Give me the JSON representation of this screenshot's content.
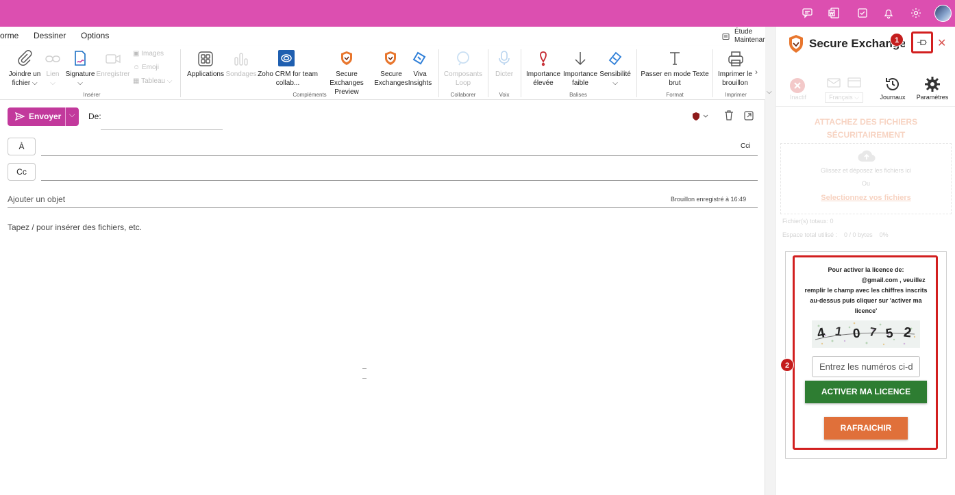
{
  "menubar": {
    "items": [
      "orme",
      "Dessiner",
      "Options"
    ],
    "etude_line1": "Étude",
    "etude_line2": "Maintenant"
  },
  "ribbon": {
    "inserer": {
      "joindre_1": "Joindre un",
      "joindre_2": "fichier",
      "lien": "Lien",
      "signature": "Signature",
      "enregistrer": "Enregistrer",
      "images": "Images",
      "emoji": "Emoji",
      "tableau": "Tableau",
      "group": "Insérer"
    },
    "complements": {
      "applications": "Applications",
      "sondages": "Sondages",
      "zoho_1": "Zoho CRM for team",
      "zoho_2": "collab...",
      "se_preview_1": "Secure Exchanges",
      "se_preview_2": "Preview",
      "se_1": "Secure",
      "se_2": "Exchanges",
      "viva_1": "Viva",
      "viva_2": "Insights",
      "group": "Compléments"
    },
    "collaborer": {
      "loop_1": "Composants",
      "loop_2": "Loop",
      "group": "Collaborer"
    },
    "voix": {
      "dicter": "Dicter",
      "group": "Voix"
    },
    "balises": {
      "imp_elev_1": "Importance",
      "imp_elev_2": "élevée",
      "imp_faib_1": "Importance",
      "imp_faib_2": "faible",
      "sensibilite": "Sensibilité",
      "group": "Balises"
    },
    "format": {
      "texte_1": "Passer en mode Texte",
      "texte_2": "brut",
      "group": "Format"
    },
    "imprimer": {
      "imp_1": "Imprimer le",
      "imp_2": "brouillon",
      "group": "Imprimer"
    }
  },
  "compose": {
    "send_label": "Envoyer",
    "from_label": "De:",
    "to_label": "À",
    "cc_label": "Cc",
    "bcc_label": "Cci",
    "subject_placeholder": "Ajouter un objet",
    "draft_status": "Brouillon enregistré à 16:49",
    "body_placeholder": "Tapez / pour insérer des fichiers, etc."
  },
  "pane": {
    "title": "Secure Exchanges",
    "tools": {
      "inactif": "Inactif",
      "langue": "Français",
      "journaux": "Journaux",
      "parametres": "Paramètres"
    },
    "attach_title_1": "ATTACHEZ DES FICHIERS",
    "attach_title_2": "SÉCURITAIREMENT",
    "drop_text": "Glissez et déposez les fichiers ici",
    "or_text": "Ou",
    "select_link": "Selectionnez vos fichiers",
    "files_total": "Fichier(s) totaux: 0",
    "space_used": "Espace total utilisé :    0 / 0 bytes    0%",
    "license": {
      "line1": "Pour activer la licence de:",
      "line2": "@gmail.com , veuillez",
      "line3": "remplir le champ avec les chiffres inscrits",
      "line4": "au-dessus puis cliquer sur 'activer ma",
      "line5": "licence'",
      "captcha_digits": [
        "4",
        "1",
        "0",
        "7",
        "5",
        "2"
      ],
      "input_placeholder": "Entrez les numéros ci-dessus",
      "activate_label": "ACTIVER MA LICENCE",
      "refresh_label": "RAFRAICHIR"
    },
    "badge1": "1",
    "badge2": "2"
  },
  "colors": {
    "topbar": "#dc4fb0",
    "send": "#c2399c",
    "activate": "#2e7d32",
    "refresh": "#e0703a",
    "highlight": "#d21f1f"
  }
}
